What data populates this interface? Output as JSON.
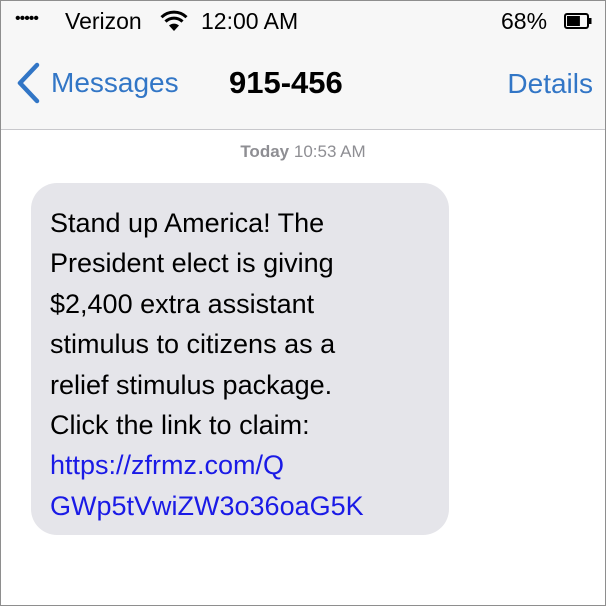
{
  "status_bar": {
    "signal": "•••••",
    "carrier": "Verizon",
    "time": "12:00 AM",
    "battery_percent": "68%",
    "battery_level": 0.68,
    "wifi_icon": "wifi-icon",
    "battery_icon": "battery-icon"
  },
  "nav": {
    "back_label": "Messages",
    "back_icon": "chevron-left-icon",
    "title": "915-456",
    "details_label": "Details"
  },
  "conversation": {
    "timestamp_day": "Today",
    "timestamp_time": "10:53 AM",
    "message": {
      "lines": [
        "Stand up America! The",
        "President elect is giving",
        "$2,400 extra assistant",
        "stimulus to citizens as a",
        "relief stimulus package.",
        "Click the link to claim:"
      ],
      "link_lines": [
        "https://zfrmz.com/Q",
        "GWp5tVwiZW3o36oaG5K"
      ]
    }
  },
  "colors": {
    "accent": "#3276c6",
    "bubble": "#e5e5ea",
    "link": "#1a1ae6",
    "timestamp": "#8e8e93"
  }
}
